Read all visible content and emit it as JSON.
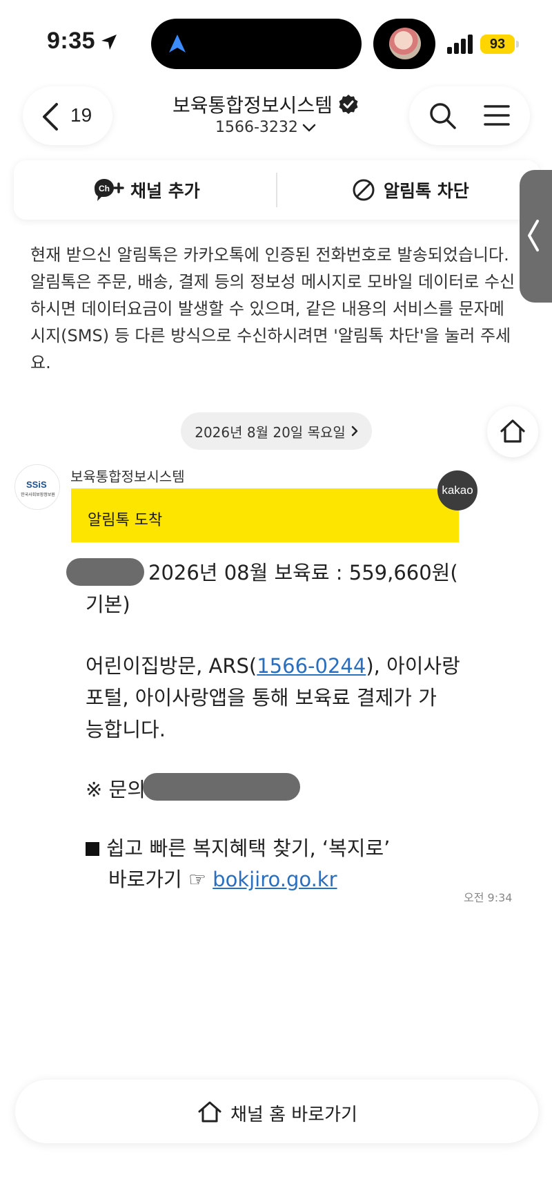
{
  "status_bar": {
    "time": "9:35",
    "battery": "93",
    "battery_color": "#ffd500"
  },
  "header": {
    "back_count": "19",
    "channel_name": "보육통합정보시스템",
    "phone": "1566-3232",
    "icons": [
      "chevron-left-icon",
      "verified-badge-icon",
      "chevron-down-icon",
      "search-icon",
      "menu-icon"
    ]
  },
  "actions": {
    "add_channel": "채널 추가",
    "block": "알림톡 차단"
  },
  "notice": {
    "text": "현재 받으신 알림톡은 카카오톡에 인증된 전화번호로 발송되었습니다. 알림톡은 주문, 배송, 결제 등의 정보성 메시지로 모바일 데이터로 수신하시면 데이터요금이 발생할 수 있으며, 같은 내용의 서비스를 문자메시지(SMS) 등 다른 방식으로 수신하시려면 '알림톡 차단'을 눌러 주세요.",
    "lines": [
      "현재 받으신 알림톡은 카카오톡에 인증된 전화번호로 발송되었습니다.",
      "알림톡은 주문, 배송, 결제 등의 정보성 메시지로 모바일 데이터로 수신",
      "하시면 데이터요금이 발생할 수 있으며, 같은 내용의 서비스를 문자메",
      "시지(SMS) 등 다른 방식으로 수신하시려면 '알림톡 차단'을 눌러 주세",
      "요."
    ]
  },
  "date_pill": "2026년 8월 20일 목요일",
  "message": {
    "sender": "보육통합정보시스템",
    "avatar_logo": "SSiS",
    "avatar_sub": "한국사회보장정보원",
    "header": "알림톡 도착",
    "kakao_badge": "kakao",
    "header_color": "#fee500",
    "line1": "2026년 08월 보육료 : 559,660원(",
    "line2": "기본)",
    "line3_a": "어린이집방문, ARS(",
    "line3_link": "1566-0244",
    "line3_b": "), 아이사랑",
    "line4": "포털, 아이사랑앱을 통해 보육료 결제가 가",
    "line5": "능합니다.",
    "line6": "※ 문의(",
    "line7": "쉽고 빠른 복지혜택 찾기, ‘복지로’",
    "line8_a": "바로가기 ☞ ",
    "line8_link": "bokjiro.go.kr",
    "time": "오전 9:34",
    "link_color": "#2a6fbf"
  },
  "bottom_bar": {
    "label": "채널 홈 바로가기"
  }
}
